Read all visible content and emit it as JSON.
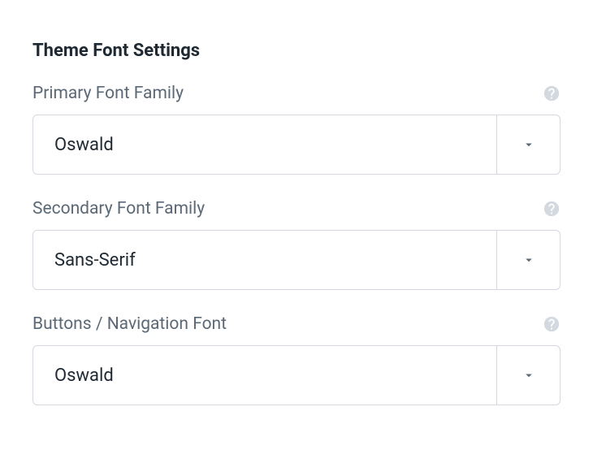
{
  "section_title": "Theme Font Settings",
  "fields": [
    {
      "label": "Primary Font Family",
      "value": "Oswald"
    },
    {
      "label": "Secondary Font Family",
      "value": "Sans-Serif"
    },
    {
      "label": "Buttons / Navigation Font",
      "value": "Oswald"
    }
  ]
}
